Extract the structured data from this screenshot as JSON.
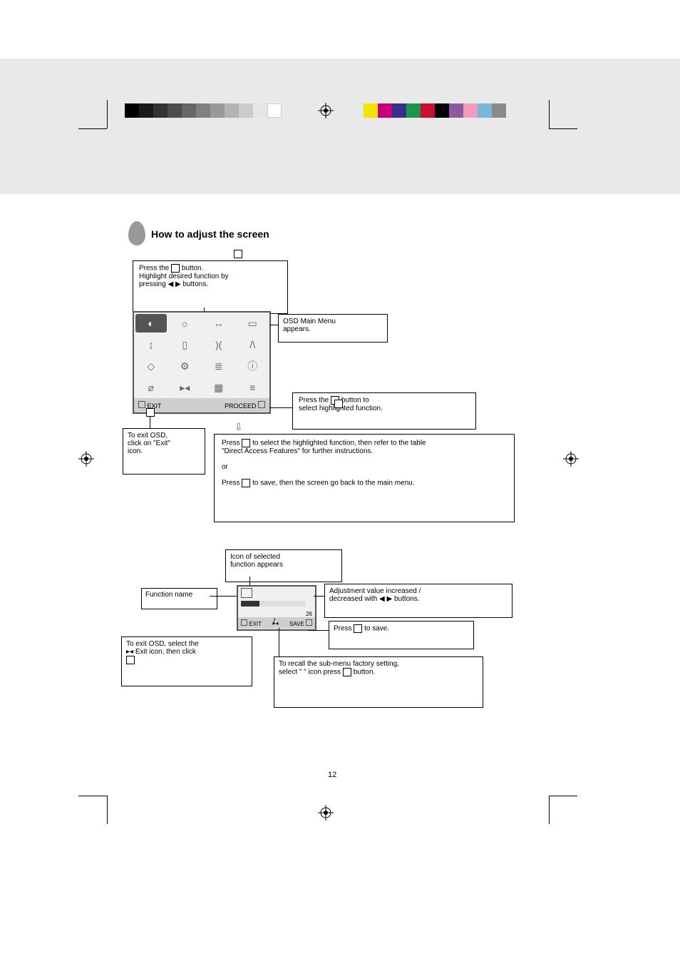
{
  "page": {
    "number": "12"
  },
  "section": {
    "title": "How to adjust the screen"
  },
  "step1": {
    "text_a": "Press the ",
    "text_b": " button.",
    "text_c": "Highlight desired function by",
    "text_d": "pressing ",
    "text_e": " buttons."
  },
  "osd_caption": {
    "line1": "OSD Main Menu",
    "line2": "appears."
  },
  "step2": {
    "text_a": "Press the ",
    "text_b": " button to",
    "text_c": "select highlighted function."
  },
  "exit1": {
    "line1": "To exit OSD,",
    "line2": "click on \"Exit\"",
    "line3": "icon."
  },
  "bigbox": {
    "l1a": "Press ",
    "l1b": " to select the highlighted function, then refer to the table",
    "l2": "\"Direct Access Features\" for further instructions.",
    "l3": "or",
    "l4a": "Press ",
    "l4b": " to save, then the screen go back to the main menu."
  },
  "sel_icon": {
    "line1": "Icon of selected",
    "line2": "function appears"
  },
  "name_box": {
    "text": "Function name"
  },
  "adj_box": {
    "line1": "Adjustment value increased /",
    "line2": "decreased with ",
    "line3": " buttons."
  },
  "save_box": {
    "text_a": "Press ",
    "text_b": " to save."
  },
  "exit2": {
    "line1": "To exit OSD, select the",
    "line2": "     ",
    "line3": "Exit icon, then click",
    "line4": "",
    "line5": ""
  },
  "recall_box": {
    "line1": "To recall the sub-menu factory setting,",
    "line2": "select \"   \" icon press ",
    "line3": " button."
  },
  "colors": {
    "gray_ramp": [
      "#000000",
      "#1a1a1a",
      "#333333",
      "#4d4d4d",
      "#666666",
      "#808080",
      "#999999",
      "#b3b3b3",
      "#cccccc",
      "#e6e6e6",
      "#ffffff"
    ],
    "color_ramp": [
      "#f2e600",
      "#c4007a",
      "#3a2e8c",
      "#1a954d",
      "#c8102e",
      "#000000",
      "#8a5a9e",
      "#f29bbb",
      "#7ab7d9",
      "#8a8a8a"
    ]
  },
  "sub_panel": {
    "value": "26",
    "exit_label": "EXIT",
    "save_label": "SAVE"
  },
  "osd_bottom": {
    "exit_label": "EXIT",
    "proceed_label": "PROCEED"
  }
}
